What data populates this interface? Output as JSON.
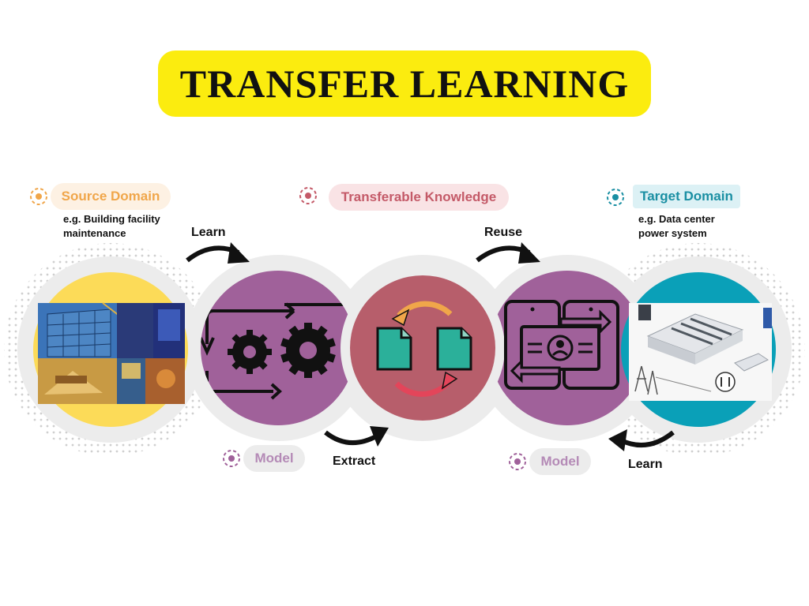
{
  "title": "TRANSFER LEARNING",
  "source": {
    "label": "Source Domain",
    "note_line1": "e.g. Building facility",
    "note_line2": "maintenance",
    "color": "#f0a64a",
    "pill_bg": "#fdf1e3",
    "circle_color": "#fcdb58"
  },
  "knowledge": {
    "label": "Transferable Knowledge",
    "color": "#c45a68",
    "pill_bg": "#f9e3e5",
    "circle_color": "#b75e6b"
  },
  "target": {
    "label": "Target Domain",
    "note_line1": "e.g. Data center",
    "note_line2": "power system",
    "color": "#1a8fa3",
    "pill_bg": "#dcf1f5",
    "circle_color": "#0aa0b8"
  },
  "model_left": {
    "label": "Model"
  },
  "model_right": {
    "label": "Model"
  },
  "model_color": "#a0619a",
  "model_label_color": "#b48ab6",
  "arrows": {
    "learn_top": "Learn",
    "extract": "Extract",
    "reuse": "Reuse",
    "learn_bottom": "Learn"
  },
  "icons": {
    "source_image": "construction-photo-collage",
    "model_left_icon": "gears-cycle-icon",
    "knowledge_icon": "document-exchange-icon",
    "model_right_icon": "money-transfer-icon",
    "target_image": "data-center-diagram"
  }
}
